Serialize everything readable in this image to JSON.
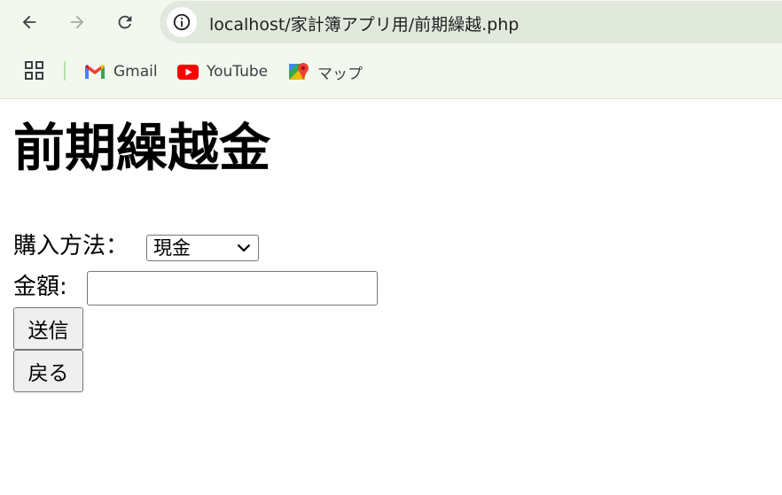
{
  "browser": {
    "url": "localhost/家計簿アプリ用/前期繰越.php",
    "bookmarks": [
      {
        "label": "Gmail",
        "icon": "gmail-icon"
      },
      {
        "label": "YouTube",
        "icon": "youtube-icon"
      },
      {
        "label": "マップ",
        "icon": "maps-icon"
      }
    ]
  },
  "page": {
    "title": "前期繰越金",
    "method_label": "購入方法：",
    "method_selected": "現金",
    "amount_label": "金額:",
    "amount_value": "",
    "submit_label": "送信",
    "back_label": "戻る"
  },
  "colors": {
    "chrome_bg": "#f3f8ee",
    "omnibox_bg": "#e1e9dc",
    "button_bg": "#efefef"
  }
}
